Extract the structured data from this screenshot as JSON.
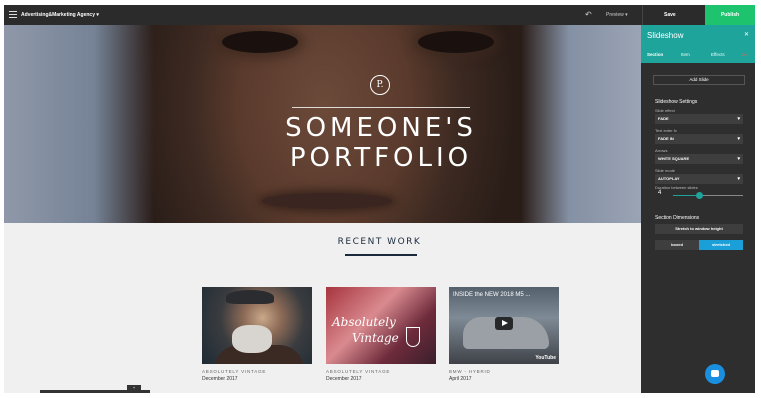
{
  "topbar": {
    "site_name": "Advertising&Marketing Agency",
    "dropdown_caret": "▾",
    "undo_glyph": "↶",
    "preview_label": "Preview  ▾",
    "save_label": "Save",
    "publish_label": "Publish"
  },
  "hero": {
    "logo_letter": "P.",
    "title_line1": "SOMEONE'S",
    "title_line2": "PORTFOLIO"
  },
  "recent": {
    "heading": "RECENT WORK",
    "cards": [
      {
        "category": "ABSOLUTELY VINTAGE",
        "date": "December 2017"
      },
      {
        "category": "ABSOLUTELY VINTAGE",
        "date": "December 2017",
        "overlay_line1": "Absolutely",
        "overlay_line2": "Vintage"
      },
      {
        "category": "BMW - HYBRID",
        "date": "April 2017",
        "video_title": "INSIDE the NEW 2018 M5 ...",
        "video_brand": "YouTube"
      }
    ]
  },
  "panel": {
    "title": "Slideshow",
    "tabs": [
      "Section",
      "Item",
      "Effects",
      "Del"
    ],
    "add_slide_label": "Add Slide",
    "settings_heading": "Slideshow Settings",
    "fields": [
      {
        "label": "Slide effect",
        "value": "FADE"
      },
      {
        "label": "Text enter fx",
        "value": "FADE IN"
      },
      {
        "label": "Arrows",
        "value": "WHITE SQUARE"
      },
      {
        "label": "Slide mode",
        "value": "AUTOPLAY"
      }
    ],
    "duration_label": "Duration between slides",
    "duration_value": "4",
    "dimensions_heading": "Section Dimensions",
    "stretch_button": "Stretch to window height",
    "boxed_label": "boxed",
    "stretched_label": "stretched"
  },
  "colors": {
    "accent_teal": "#1fa49c",
    "publish_green": "#1ec36e",
    "toggle_blue": "#1a9fd9",
    "chat_blue": "#1a8fe0"
  }
}
